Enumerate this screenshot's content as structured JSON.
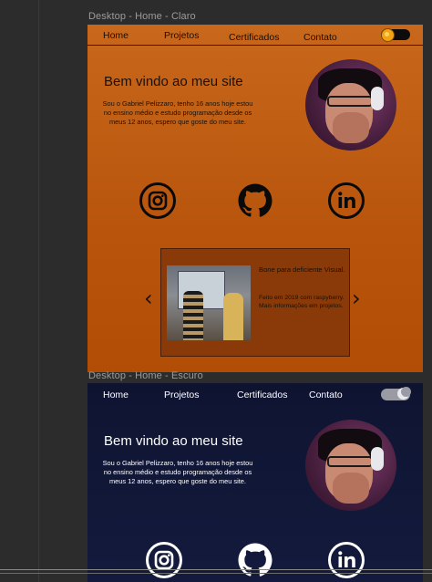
{
  "frames": {
    "light_label": "Desktop - Home - Claro",
    "dark_label": "Desktop - Home - Escuro"
  },
  "nav": {
    "items": [
      "Home",
      "Projetos",
      "Certificados",
      "Contato"
    ]
  },
  "hero": {
    "title": "Bem vindo ao meu site",
    "text": "Sou o Gabriel Pelizzaro, tenho 16 anos hoje estou no ensino médio e estudo programação desde os meus 12 anos, espero que goste do meu site."
  },
  "social": {
    "icons": [
      "instagram-icon",
      "github-icon",
      "linkedin-icon"
    ]
  },
  "carousel": {
    "title": "Bone para deficiente Visual.",
    "text_line1": "Feito em 2019 com raspyberry.",
    "text_line2": "Mais informações em projetos.",
    "prev": "‹",
    "next": "›"
  },
  "colors": {
    "light_bg": "#c8681c",
    "dark_bg": "#121838",
    "sun": "#f2a213"
  }
}
